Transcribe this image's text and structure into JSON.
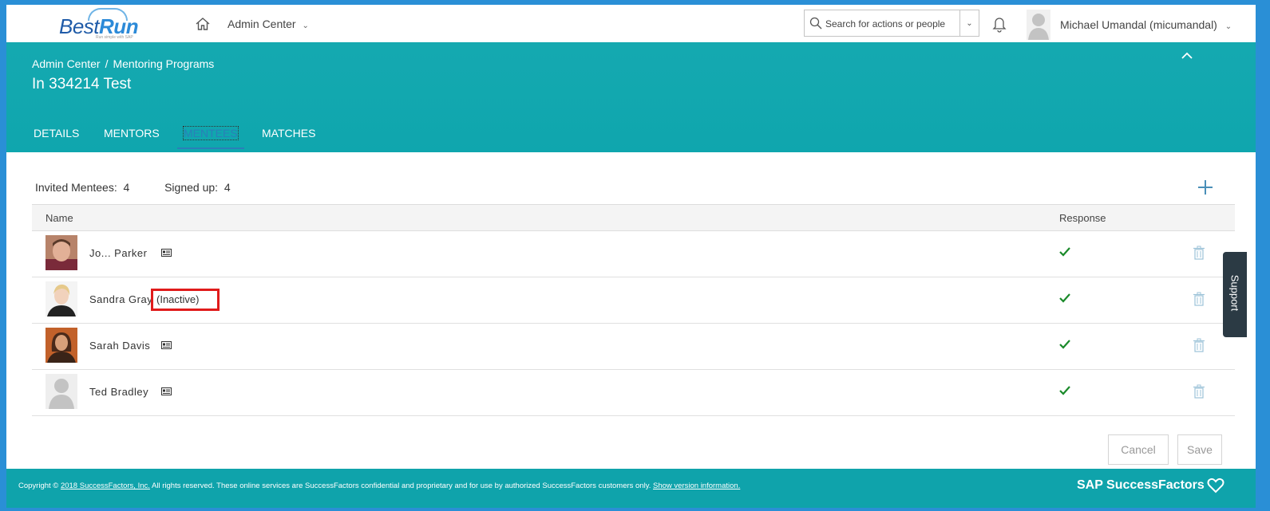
{
  "app": {
    "logo_best": "Best",
    "logo_run": "Run",
    "logo_tagline": "Run simple with SAP"
  },
  "topbar": {
    "nav_label": "Admin Center",
    "search_placeholder": "Search for actions or people",
    "user_name": "Michael Umandal (micumandal)"
  },
  "header": {
    "breadcrumb": [
      "Admin Center",
      "Mentoring Programs"
    ],
    "breadcrumb_sep": "/",
    "title": "In 334214 Test",
    "tabs": [
      {
        "label": "DETAILS",
        "active": false
      },
      {
        "label": "MENTORS",
        "active": false
      },
      {
        "label": "MENTEES",
        "active": true
      },
      {
        "label": "MATCHES",
        "active": false
      }
    ]
  },
  "stats": {
    "invited_label": "Invited Mentees:",
    "invited_value": "4",
    "signed_label": "Signed up:",
    "signed_value": "4"
  },
  "table": {
    "columns": [
      "Name",
      "Response"
    ],
    "rows": [
      {
        "name": "Jo... Parker",
        "inactive": "",
        "response": "accepted"
      },
      {
        "name": "Sandra Gray",
        "inactive": "(Inactive)",
        "response": "accepted"
      },
      {
        "name": "Sarah Davis",
        "inactive": "",
        "response": "accepted"
      },
      {
        "name": "Ted Bradley",
        "inactive": "",
        "response": "accepted"
      }
    ]
  },
  "actions": {
    "cancel": "Cancel",
    "save": "Save"
  },
  "footer": {
    "copyright_prefix": "Copyright ©",
    "company_link": "2018 SuccessFactors, Inc.",
    "copyright_rest": "All rights reserved. These online services are SuccessFactors confidential and proprietary and for use by authorized SuccessFactors customers only.",
    "version_link": "Show version information.",
    "brand": "SAP SuccessFactors"
  },
  "support": {
    "label": "Support"
  },
  "colors": {
    "teal": "#0fa6ae",
    "accent": "#2a7fb8",
    "check": "#1a8a2a",
    "highlight": "#e01b1b"
  }
}
